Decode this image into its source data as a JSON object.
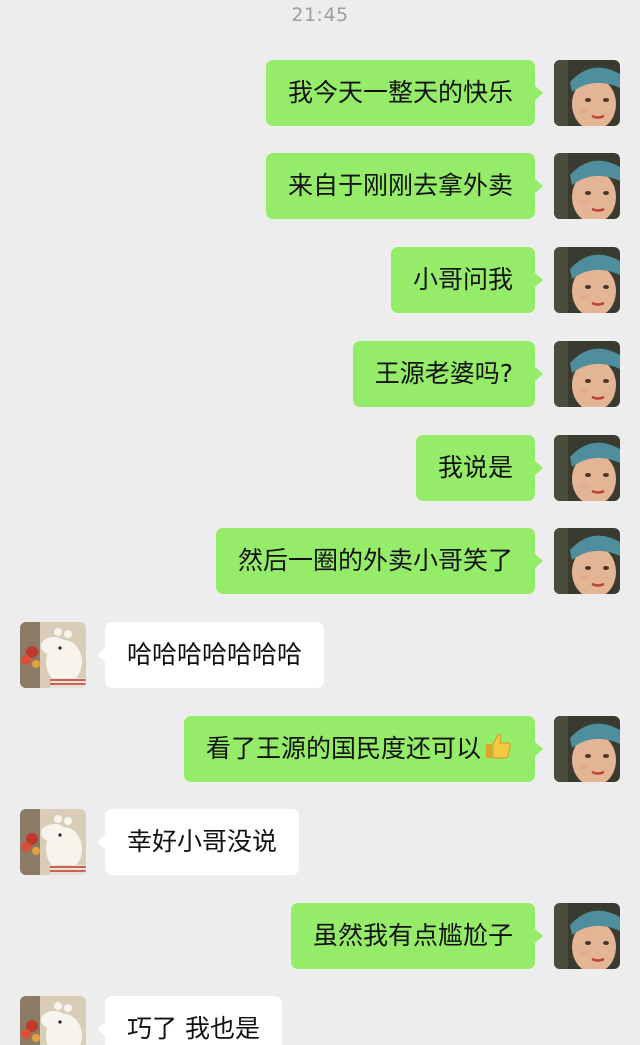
{
  "status": {
    "time": "21:45"
  },
  "messages": [
    {
      "side": "me",
      "text": "我今天一整天的快乐",
      "avatar": "portrait-avatar"
    },
    {
      "side": "me",
      "text": "来自于刚刚去拿外卖",
      "avatar": "portrait-avatar"
    },
    {
      "side": "me",
      "text": "小哥问我",
      "avatar": "portrait-avatar"
    },
    {
      "side": "me",
      "text": "王源老婆吗?",
      "avatar": "portrait-avatar"
    },
    {
      "side": "me",
      "text": "我说是",
      "avatar": "portrait-avatar"
    },
    {
      "side": "me",
      "text": "然后一圈的外卖小哥笑了",
      "avatar": "portrait-avatar"
    },
    {
      "side": "other",
      "text": "哈哈哈哈哈哈哈",
      "avatar": "moomin-avatar"
    },
    {
      "side": "me",
      "text": "看了王源的国民度还可以",
      "emoji": "thumbs-up-icon",
      "avatar": "portrait-avatar"
    },
    {
      "side": "other",
      "text": "幸好小哥没说",
      "avatar": "moomin-avatar"
    },
    {
      "side": "me",
      "text": "虽然我有点尴尬子",
      "avatar": "portrait-avatar"
    },
    {
      "side": "other",
      "text": "巧了 我也是",
      "avatar": "moomin-avatar"
    }
  ],
  "colors": {
    "background": "#ededed",
    "my_bubble": "#95ec69",
    "their_bubble": "#ffffff",
    "time_text": "#9e9e9e"
  }
}
